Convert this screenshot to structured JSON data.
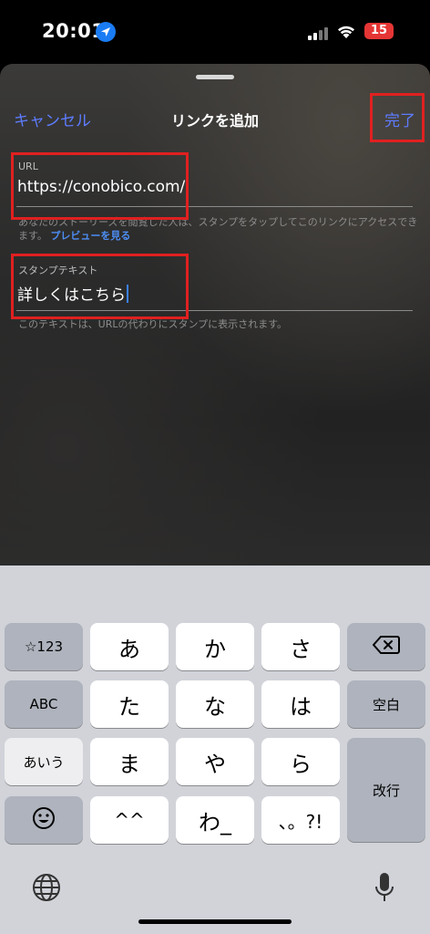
{
  "status_bar": {
    "time": "20:01",
    "battery": "15"
  },
  "header": {
    "cancel_label": "キャンセル",
    "title": "リンクを追加",
    "done_label": "完了"
  },
  "url_field": {
    "label": "URL",
    "value": "https://conobico.com/",
    "help_text": "あなたのストーリーズを閲覧した人は、スタンプをタップしてこのリンクにアクセスできます。",
    "preview_link": "プレビューを見る"
  },
  "sticker_field": {
    "label": "スタンプテキスト",
    "value": "詳しくはこちら",
    "help_text": "このテキストは、URLの代わりにスタンプに表示されます。"
  },
  "keyboard": {
    "row1": {
      "left": "☆123",
      "k1": "あ",
      "k2": "か",
      "k3": "さ"
    },
    "row2": {
      "left": "ABC",
      "k1": "た",
      "k2": "な",
      "k3": "は",
      "right": "空白"
    },
    "row3": {
      "left": "あいう",
      "k1": "ま",
      "k2": "や",
      "k3": "ら",
      "right": "改行"
    },
    "row4": {
      "k1": "^^",
      "k2": "わ_",
      "k3": "、。?!"
    }
  },
  "accent_color": "#5e7cff",
  "highlight_color": "#e02020",
  "icons": [
    "location-arrow-icon",
    "signal-icon",
    "wifi-icon",
    "battery-icon",
    "backspace-icon",
    "emoji-icon",
    "globe-icon",
    "microphone-icon"
  ]
}
